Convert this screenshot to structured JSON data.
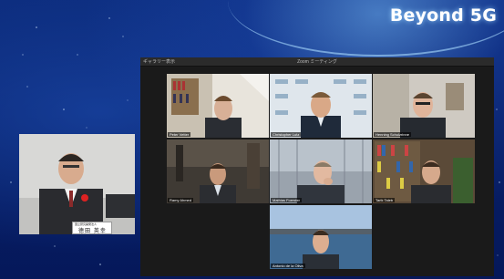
{
  "banner": {
    "title": "Beyond 5G"
  },
  "zoom": {
    "window_title": "Zoom ミーティング",
    "view_label": "ギャラリー表示"
  },
  "participants": [
    {
      "name": "Peter Vetter"
    },
    {
      "name": "Christopher Lutz"
    },
    {
      "name": "Henning Schulzrinne"
    },
    {
      "name": "Ramy Ahmed"
    },
    {
      "name": "Mathias Foerster"
    },
    {
      "name": "Tarik Taleb"
    },
    {
      "name": "Antonio de la Oliva"
    }
  ],
  "speaker": {
    "nameplate_label": "国立研究開発法人",
    "nameplate_name": "徳田 英幸"
  },
  "colors": {
    "background": "#0a1f5c",
    "zoom_bg": "#1a1a1a",
    "title_glow": "#96d2ff"
  }
}
